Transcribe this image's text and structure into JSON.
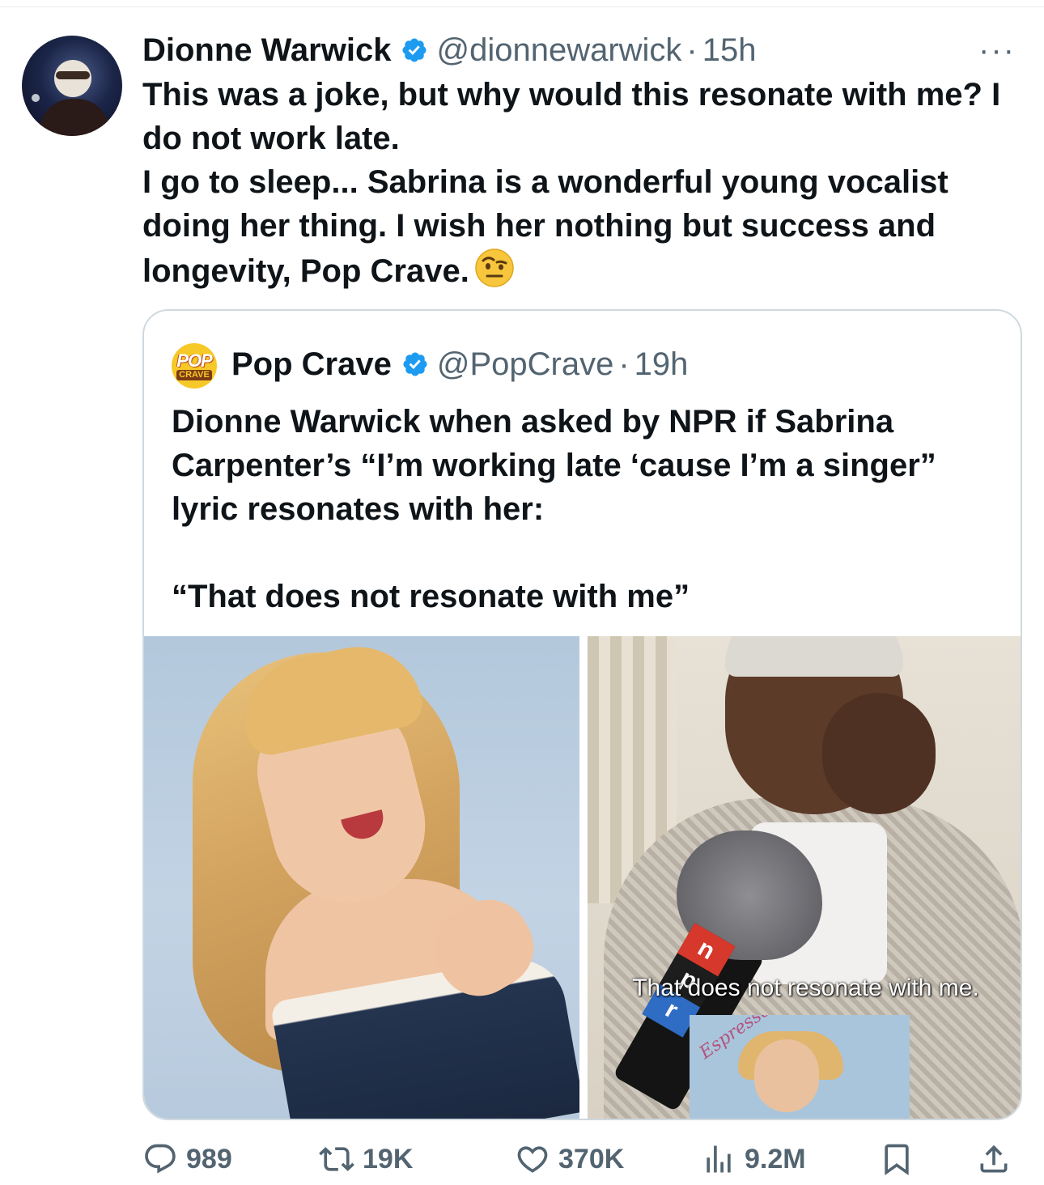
{
  "tweet": {
    "author_name": "Dionne Warwick",
    "author_handle": "@dionnewarwick",
    "separator": "·",
    "time": "15h",
    "more_label": "···",
    "text": "This was a joke, but why would this resonate with me? I do not work late.\nI go to sleep... Sabrina is a wonderful young vocalist doing her thing. I wish her nothing but success and longevity, Pop Crave.",
    "emoji": "face-with-raised-eyebrow"
  },
  "quoted_tweet": {
    "logo_top": "POP",
    "logo_bottom": "CRAVE",
    "author_name": "Pop Crave",
    "author_handle": "@PopCrave",
    "separator": "·",
    "time": "19h",
    "text": "Dionne Warwick when asked by NPR if Sabrina Carpenter’s “I’m working late ‘cause I’m a singer” lyric resonates with her:\n\n“That does not resonate with me”",
    "media": {
      "right_caption": "That does not resonate with me.",
      "mic_flag_letters": [
        "n",
        "p",
        "r"
      ],
      "album_title": "Espresso"
    }
  },
  "actions": {
    "replies": "989",
    "reposts": "19K",
    "likes": "370K",
    "views": "9.2M"
  },
  "colors": {
    "text": "#0f1419",
    "secondary": "#536471",
    "verified": "#1d9bf0",
    "border": "#cfd9de"
  }
}
